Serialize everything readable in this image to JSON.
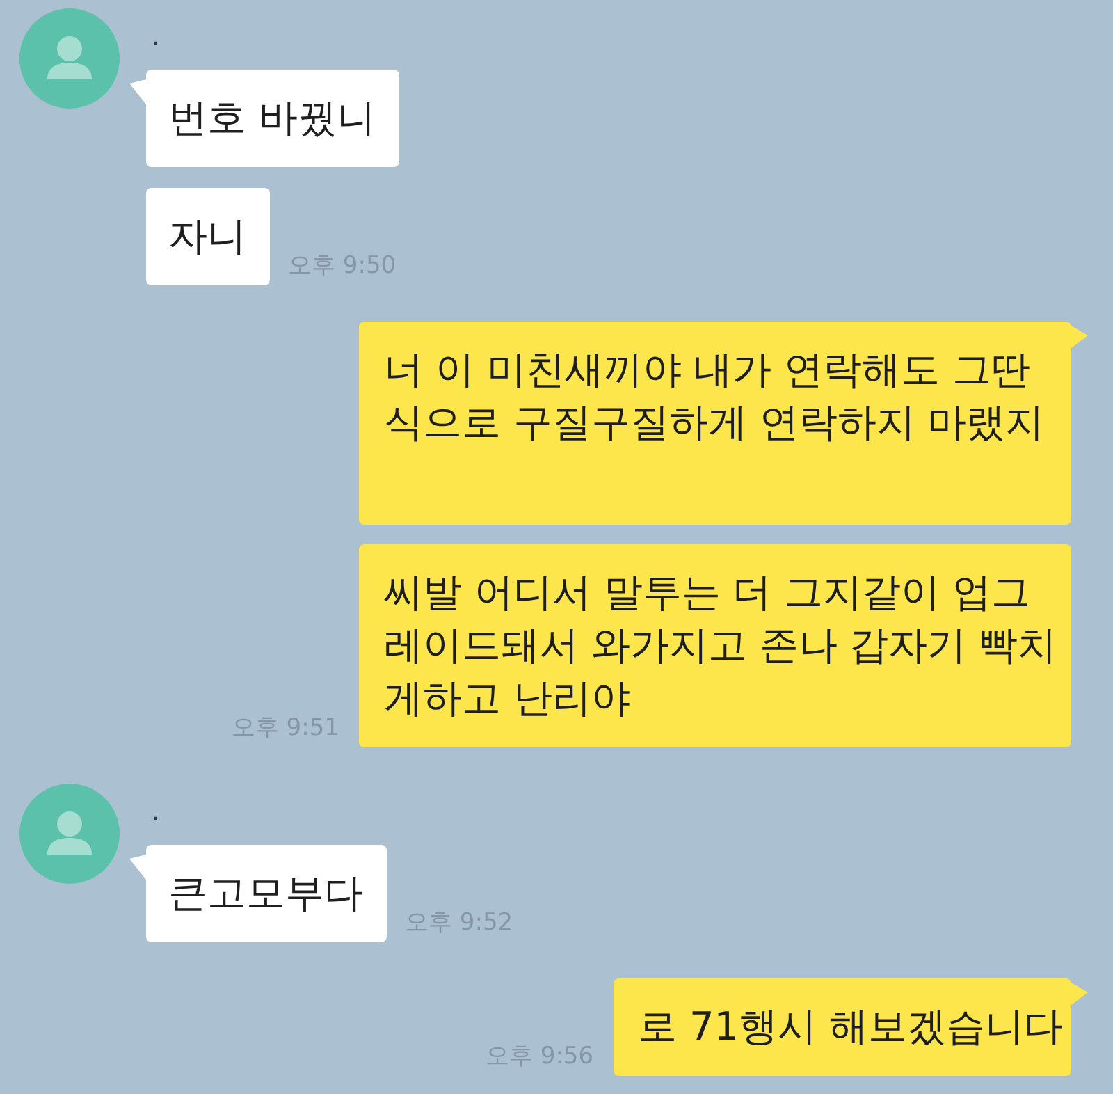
{
  "messages": [
    {
      "kind": "received",
      "name": ".",
      "bubbles": [
        {
          "text": "번호 바꿨니"
        },
        {
          "text": "자니",
          "time": "오후 9:50"
        }
      ]
    },
    {
      "kind": "sent",
      "bubbles": [
        {
          "text": "너 이 미친새끼야 내가 연락해도 그딴식으로 구질구질하게 연락하지 마랬지\n"
        },
        {
          "text": "씨발 어디서 말투는 더 그지같이 업그레이드돼서 와가지고 존나 갑자기 빡치게하고 난리야",
          "time": "오후 9:51"
        }
      ]
    },
    {
      "kind": "received",
      "name": ".",
      "bubbles": [
        {
          "text": "큰고모부다",
          "time": "오후 9:52"
        }
      ]
    },
    {
      "kind": "sent",
      "bubbles": [
        {
          "text": "로 71행시 해보겠습니다",
          "time": "오후 9:56"
        }
      ]
    }
  ]
}
